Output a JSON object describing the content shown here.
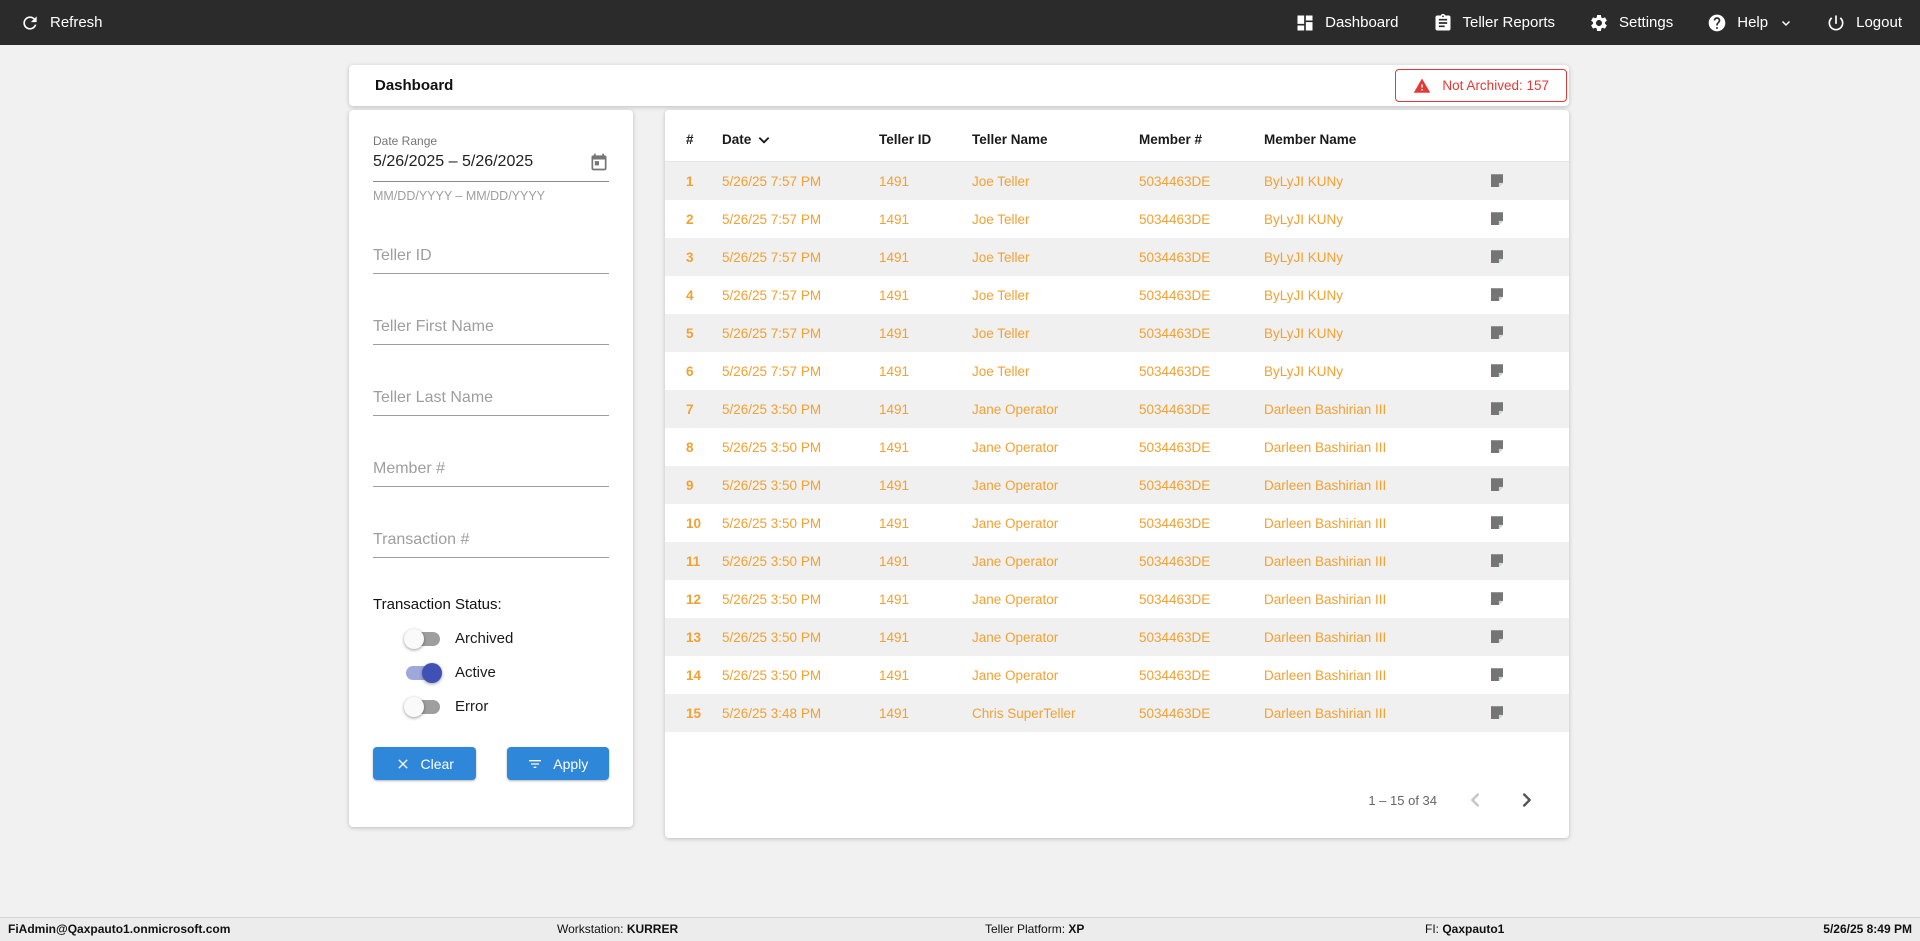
{
  "topbar": {
    "refresh_label": "Refresh",
    "refresh_icon": "refresh-icon",
    "nav_items": [
      {
        "label": "Dashboard",
        "icon": "dashboard-icon"
      },
      {
        "label": "Teller Reports",
        "icon": "clipboard-icon"
      },
      {
        "label": "Settings",
        "icon": "gear-icon"
      },
      {
        "label": "Help",
        "icon": "help-icon",
        "chevron": "chevron-down-icon"
      },
      {
        "label": "Logout",
        "icon": "power-icon"
      }
    ]
  },
  "header": {
    "title": "Dashboard",
    "badge_label": "Not Archived: 157",
    "badge_icon": "warning-icon",
    "badge_color": "#e53935"
  },
  "filters": {
    "date_range_label": "Date Range",
    "date_range_value": "5/26/2025 – 5/26/2025",
    "date_range_hint": "MM/DD/YYYY – MM/DD/YYYY",
    "date_icon": "calendar-icon",
    "text_inputs": [
      {
        "placeholder": "Teller ID"
      },
      {
        "placeholder": "Teller First Name"
      },
      {
        "placeholder": "Teller Last Name"
      },
      {
        "placeholder": "Member #"
      },
      {
        "placeholder": "Transaction #"
      }
    ],
    "status_label": "Transaction Status:",
    "status_toggles": [
      {
        "label": "Archived",
        "on": false
      },
      {
        "label": "Active",
        "on": true
      },
      {
        "label": "Error",
        "on": false
      }
    ],
    "clear_label": "Clear",
    "apply_label": "Apply",
    "button_color": "#2e87d8",
    "toggle_on_color": "#3f51b5"
  },
  "table": {
    "columns": [
      "#",
      "Date",
      "Teller ID",
      "Teller Name",
      "Member #",
      "Member Name"
    ],
    "sorted_column": "Date",
    "sort_direction": "desc",
    "row_text_color": "#f2a132",
    "row_icon": "note-icon",
    "rows": [
      {
        "n": "1",
        "date": "5/26/25 7:57 PM",
        "teller_id": "1491",
        "teller_name": "Joe Teller",
        "member": "5034463DE",
        "member_name": "ByLyJI KUNy"
      },
      {
        "n": "2",
        "date": "5/26/25 7:57 PM",
        "teller_id": "1491",
        "teller_name": "Joe Teller",
        "member": "5034463DE",
        "member_name": "ByLyJI KUNy"
      },
      {
        "n": "3",
        "date": "5/26/25 7:57 PM",
        "teller_id": "1491",
        "teller_name": "Joe Teller",
        "member": "5034463DE",
        "member_name": "ByLyJI KUNy"
      },
      {
        "n": "4",
        "date": "5/26/25 7:57 PM",
        "teller_id": "1491",
        "teller_name": "Joe Teller",
        "member": "5034463DE",
        "member_name": "ByLyJI KUNy"
      },
      {
        "n": "5",
        "date": "5/26/25 7:57 PM",
        "teller_id": "1491",
        "teller_name": "Joe Teller",
        "member": "5034463DE",
        "member_name": "ByLyJI KUNy"
      },
      {
        "n": "6",
        "date": "5/26/25 7:57 PM",
        "teller_id": "1491",
        "teller_name": "Joe Teller",
        "member": "5034463DE",
        "member_name": "ByLyJI KUNy"
      },
      {
        "n": "7",
        "date": "5/26/25 3:50 PM",
        "teller_id": "1491",
        "teller_name": "Jane Operator",
        "member": "5034463DE",
        "member_name": "Darleen Bashirian III"
      },
      {
        "n": "8",
        "date": "5/26/25 3:50 PM",
        "teller_id": "1491",
        "teller_name": "Jane Operator",
        "member": "5034463DE",
        "member_name": "Darleen Bashirian III"
      },
      {
        "n": "9",
        "date": "5/26/25 3:50 PM",
        "teller_id": "1491",
        "teller_name": "Jane Operator",
        "member": "5034463DE",
        "member_name": "Darleen Bashirian III"
      },
      {
        "n": "10",
        "date": "5/26/25 3:50 PM",
        "teller_id": "1491",
        "teller_name": "Jane Operator",
        "member": "5034463DE",
        "member_name": "Darleen Bashirian III"
      },
      {
        "n": "11",
        "date": "5/26/25 3:50 PM",
        "teller_id": "1491",
        "teller_name": "Jane Operator",
        "member": "5034463DE",
        "member_name": "Darleen Bashirian III"
      },
      {
        "n": "12",
        "date": "5/26/25 3:50 PM",
        "teller_id": "1491",
        "teller_name": "Jane Operator",
        "member": "5034463DE",
        "member_name": "Darleen Bashirian III"
      },
      {
        "n": "13",
        "date": "5/26/25 3:50 PM",
        "teller_id": "1491",
        "teller_name": "Jane Operator",
        "member": "5034463DE",
        "member_name": "Darleen Bashirian III"
      },
      {
        "n": "14",
        "date": "5/26/25 3:50 PM",
        "teller_id": "1491",
        "teller_name": "Jane Operator",
        "member": "5034463DE",
        "member_name": "Darleen Bashirian III"
      },
      {
        "n": "15",
        "date": "5/26/25 3:48 PM",
        "teller_id": "1491",
        "teller_name": "Chris SuperTeller",
        "member": "5034463DE",
        "member_name": "Darleen Bashirian III"
      }
    ],
    "pagination": {
      "label": "1 – 15 of 34",
      "prev_icon": "chevron-left-icon",
      "next_icon": "chevron-right-icon",
      "prev_enabled": false,
      "next_enabled": true
    }
  },
  "footer": {
    "user": "FiAdmin@Qaxpauto1.onmicrosoft.com",
    "workstation_label": "Workstation: ",
    "workstation_value": "KURRER",
    "platform_label": "Teller Platform: ",
    "platform_value": "XP",
    "fi_label": "FI: ",
    "fi_value": "Qaxpauto1",
    "datetime": "5/26/25 8:49 PM"
  }
}
